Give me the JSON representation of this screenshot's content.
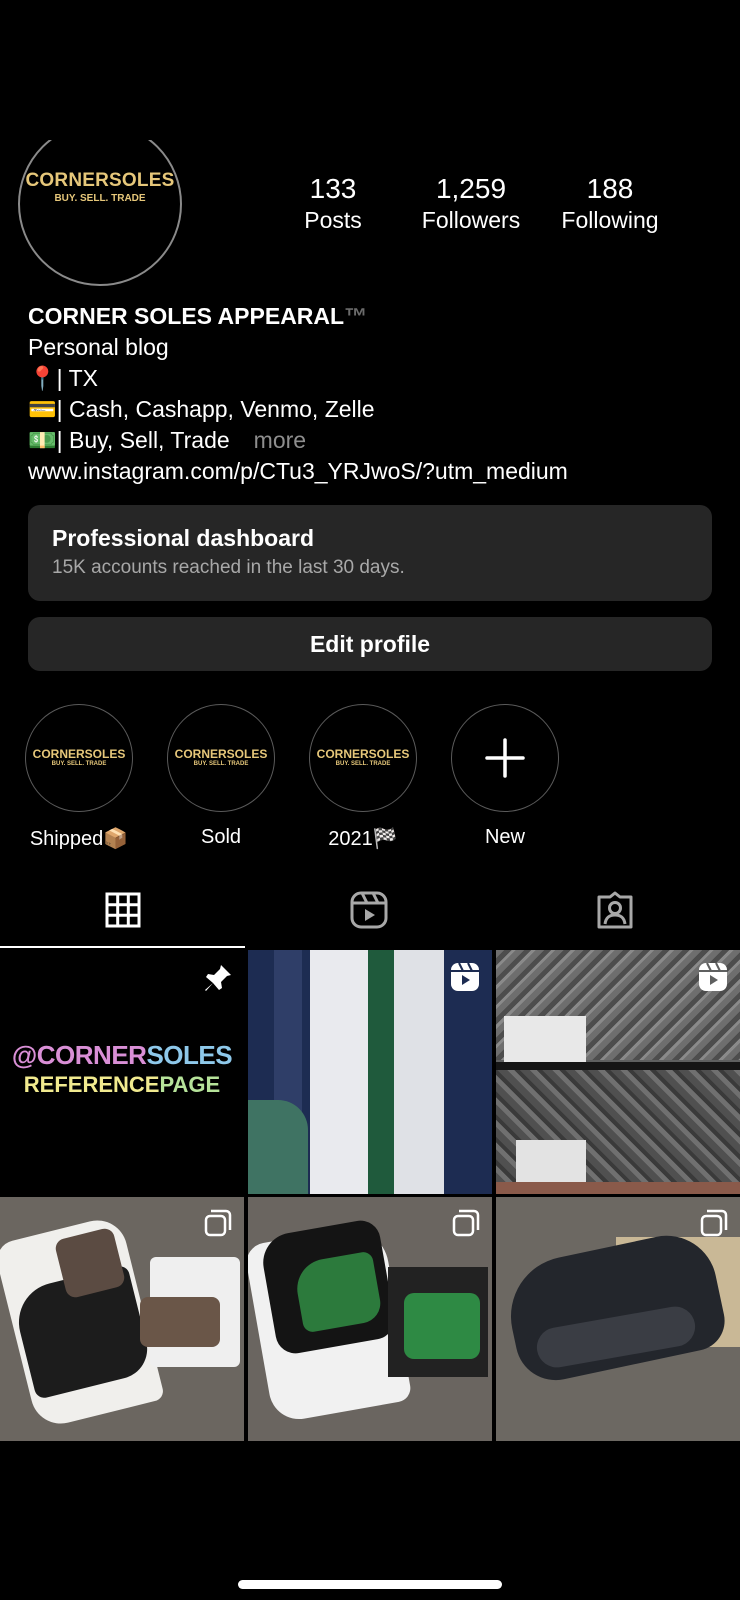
{
  "profile": {
    "logo_text": "CORNERSOLES",
    "logo_tagline": "BUY. SELL. TRADE",
    "stats": [
      {
        "value": "133",
        "label": "Posts"
      },
      {
        "value": "1,259",
        "label": "Followers"
      },
      {
        "value": "188",
        "label": "Following"
      }
    ],
    "name": "CORNER SOLES APPEARAL",
    "trademark": "™",
    "category": "Personal blog",
    "bio_lines": [
      "📍| TX",
      "💳| Cash, Cashapp, Venmo, Zelle",
      "💵| Buy, Sell, Trade"
    ],
    "more_label": "more",
    "link": "www.instagram.com/p/CTu3_YRJwoS/?utm_medium"
  },
  "dashboard": {
    "title": "Professional dashboard",
    "subtitle": "15K accounts reached in the last 30 days."
  },
  "edit_profile_label": "Edit profile",
  "highlights": [
    {
      "label": "Shipped📦",
      "logo": "CORNERSOLES",
      "tagline": "BUY. SELL. TRADE"
    },
    {
      "label": "Sold",
      "logo": "CORNERSOLES",
      "tagline": "BUY. SELL. TRADE"
    },
    {
      "label": "2021🏁",
      "logo": "CORNERSOLES",
      "tagline": "BUY. SELL. TRADE"
    },
    {
      "label": "New",
      "icon": "plus-icon"
    }
  ],
  "tabs": [
    {
      "icon": "grid-icon",
      "active": true
    },
    {
      "icon": "reels-icon",
      "active": false
    },
    {
      "icon": "tagged-icon",
      "active": false
    }
  ],
  "posts": [
    {
      "type": "pinned",
      "icon": "pin-icon",
      "line1_at": "@",
      "line1_a": "CORNER",
      "line1_b": "SOLES",
      "line2_a": "REFERENCE",
      "line2_b": "PAGE"
    },
    {
      "type": "reel",
      "icon": "reel-icon"
    },
    {
      "type": "reel",
      "icon": "reel-icon"
    },
    {
      "type": "carousel",
      "icon": "carousel-icon"
    },
    {
      "type": "carousel",
      "icon": "carousel-icon"
    },
    {
      "type": "carousel",
      "icon": "carousel-icon"
    }
  ],
  "colors": {
    "background": "#000000",
    "button": "#262626",
    "logo_gold": "#e6c77a",
    "muted": "#8e8e8e"
  }
}
